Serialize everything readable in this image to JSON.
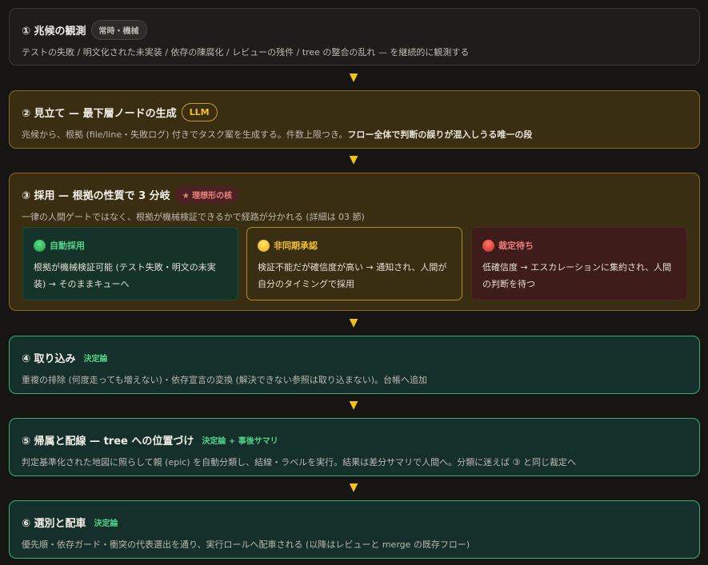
{
  "steps": [
    {
      "title": "① 兆候の観測",
      "badge": "常時・機械",
      "desc": "テストの失敗 / 明文化された未実装 / 依存の陳腐化 / レビューの残件 / tree の整合の乱れ — を継続的に観測する"
    },
    {
      "title": "② 見立て — 最下層ノードの生成",
      "badge": "LLM",
      "desc": "兆候から、根拠 (file/line・失敗ログ) 付きでタスク案を生成する。件数上限つき。",
      "desc_bold": "フロー全体で判断の誤りが混入しうる唯一の段"
    },
    {
      "title": "③ 採用 — 根拠の性質で 3 分岐",
      "badge": "★ 理想形の核",
      "desc": "一律の人間ゲートではなく、根拠が機械検証できるかで経路が分かれる (詳細は 03 節)",
      "branches": [
        {
          "label": "自動採用",
          "text": "根拠が機械検証可能 (テスト失敗・明文の未実装) → そのままキューへ"
        },
        {
          "label": "非同期承認",
          "text": "検証不能だが確信度が高い → 通知され、人間が自分のタイミングで採用"
        },
        {
          "label": "裁定待ち",
          "text": "低確信度 → エスカレーションに集約され、人間の判断を待つ"
        }
      ]
    },
    {
      "title": "④ 取り込み",
      "badge": "決定論",
      "desc": "重複の排除 (何度走っても増えない)・依存宣言の変換 (解決できない参照は取り込まない)。台帳へ追加"
    },
    {
      "title": "⑤ 帰属と配線 — tree への位置づけ",
      "badge": "決定論 + 事後サマリ",
      "desc": "判定基準化された地図に照らして親 (epic) を自動分類し、結線・ラベルを実行。結果は差分サマリで人間へ。分類に迷えば ③ と同じ裁定へ"
    },
    {
      "title": "⑥ 選別と配車",
      "badge": "決定論",
      "desc": "優先順・依存ガード・衝突の代表選出を通り、実行ロールへ配車される (以降はレビューと merge の既存フロー)"
    }
  ],
  "arrow_glyph": "▼",
  "colors": {
    "background": "#161514",
    "neutral_card": "#1e1d1b",
    "amber_card": "#3a2e12",
    "amber_border": "#8a6a22",
    "green_card": "#15302a",
    "green_border": "#34b072",
    "arrow": "#f2c21b",
    "green_text": "#4fd48a",
    "yellow_text": "#f2c230",
    "red_text": "#f07a7a"
  },
  "icons": [
    "green-circle-icon",
    "yellow-circle-icon",
    "red-circle-icon",
    "star-icon"
  ]
}
